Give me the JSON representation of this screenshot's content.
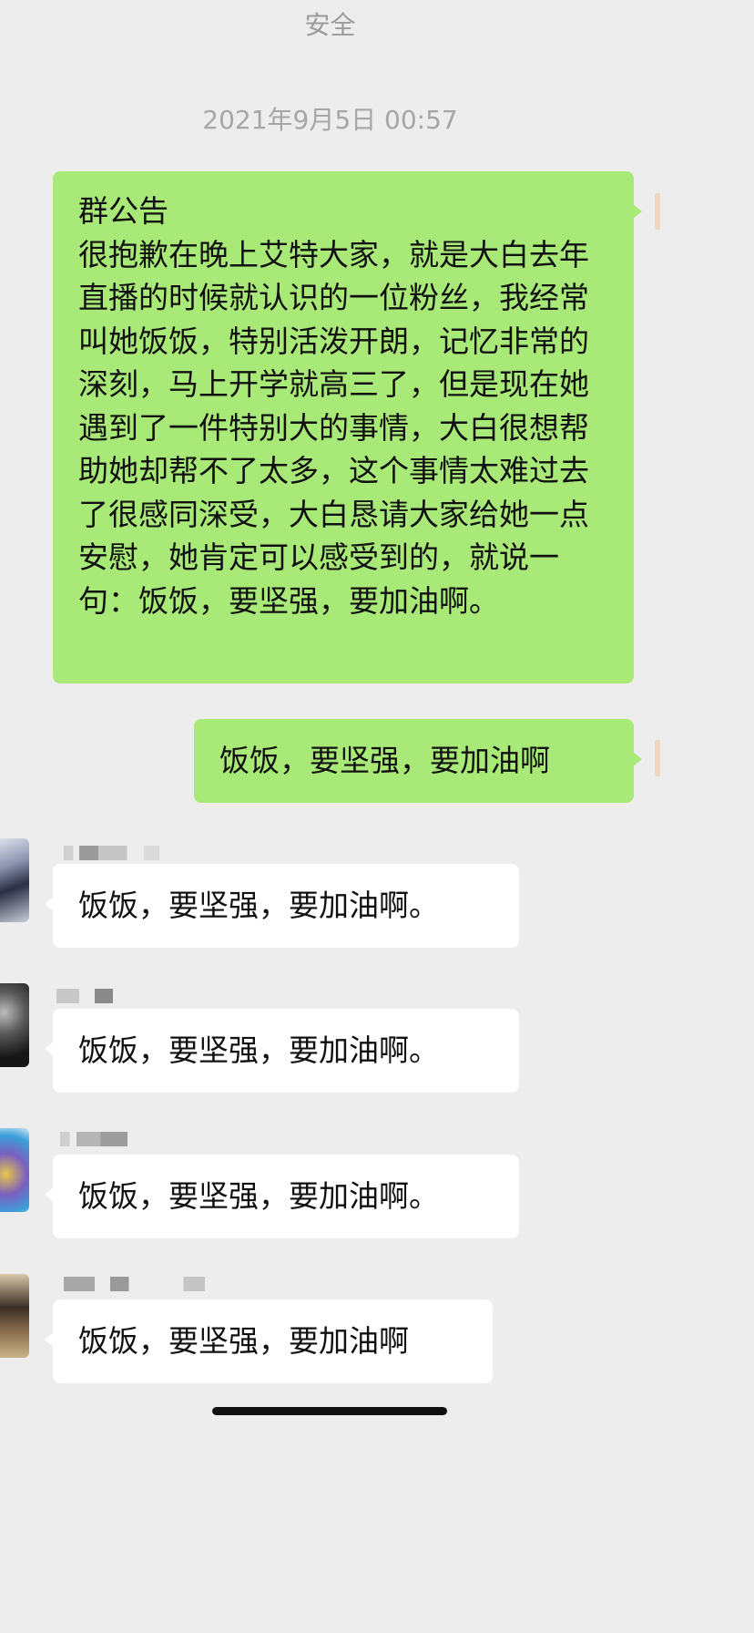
{
  "header": {
    "title": "安全"
  },
  "timestamp": "2021年9月5日 00:57",
  "announcement": {
    "title": "群公告",
    "body": "很抱歉在晚上艾特大家，就是大白去年直播的时候就认识的一位粉丝，我经常叫她饭饭，特别活泼开朗，记忆非常的深刻，马上开学就高三了，但是现在她遇到了一件特别大的事情，大白很想帮助她却帮不了太多，这个事情太难过去了很感同深受，大白恳请大家给她一点安慰，她肯定可以感受到的，就说一句：饭饭，要坚强，要加油啊。"
  },
  "my_reply": "饭饭，要坚强，要加油啊",
  "messages": [
    {
      "text": "饭饭，要坚强，要加油啊。"
    },
    {
      "text": "饭饭，要坚强，要加油啊。"
    },
    {
      "text": "饭饭，要坚强，要加油啊。"
    },
    {
      "text": "饭饭，要坚强，要加油啊"
    }
  ],
  "colors": {
    "background": "#ededed",
    "mine_bubble": "#a9e978",
    "their_bubble": "#ffffff"
  }
}
